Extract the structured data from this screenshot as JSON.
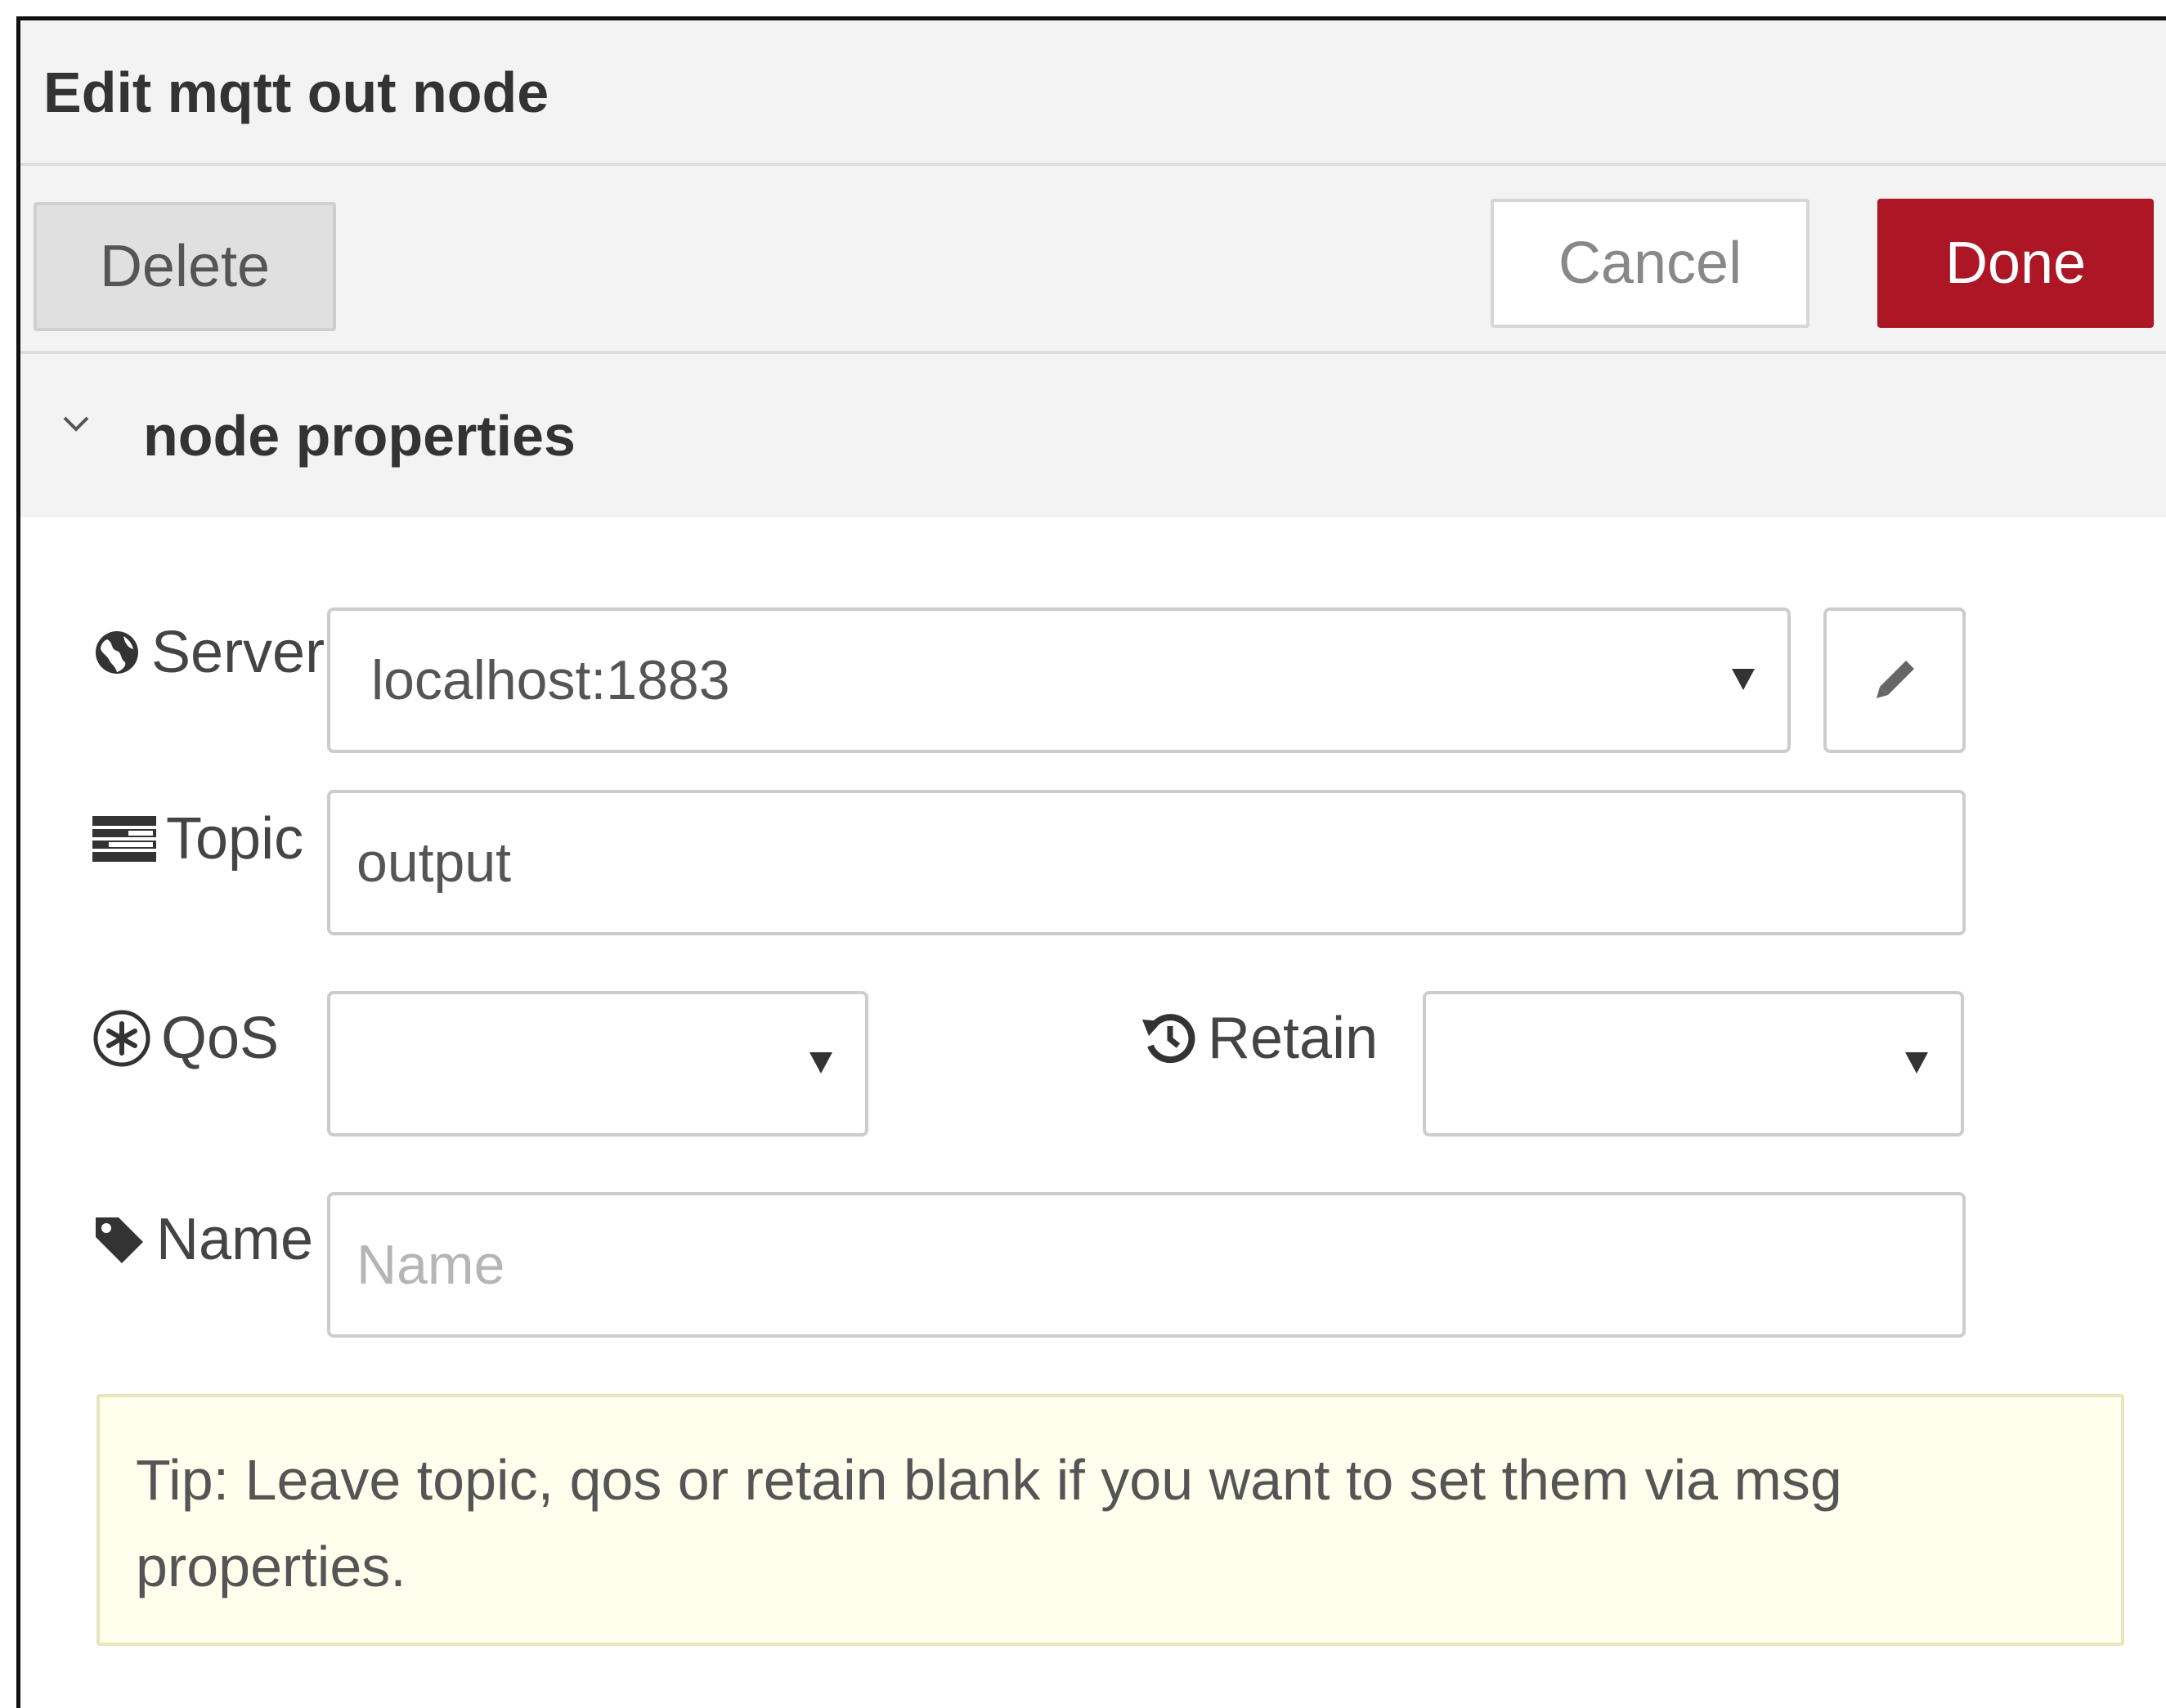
{
  "dialog": {
    "title": "Edit mqtt out node"
  },
  "toolbar": {
    "delete_label": "Delete",
    "cancel_label": "Cancel",
    "done_label": "Done"
  },
  "section": {
    "title": "node properties",
    "expanded": true
  },
  "form": {
    "server": {
      "label": "Server",
      "icon": "globe-icon",
      "value": "localhost:1883"
    },
    "topic": {
      "label": "Topic",
      "icon": "tasks-icon",
      "value": "output"
    },
    "qos": {
      "label": "QoS",
      "icon": "asterisk-circle-icon",
      "value": ""
    },
    "retain": {
      "label": "Retain",
      "icon": "history-icon",
      "value": ""
    },
    "name": {
      "label": "Name",
      "icon": "tag-icon",
      "value": "",
      "placeholder": "Name"
    }
  },
  "tip": {
    "text": "Tip: Leave topic, qos or retain blank if you want to set them via msg properties."
  },
  "colors": {
    "done_button": "#ad1625",
    "header_bg": "#f3f3f3",
    "tip_bg": "#ffffee"
  }
}
